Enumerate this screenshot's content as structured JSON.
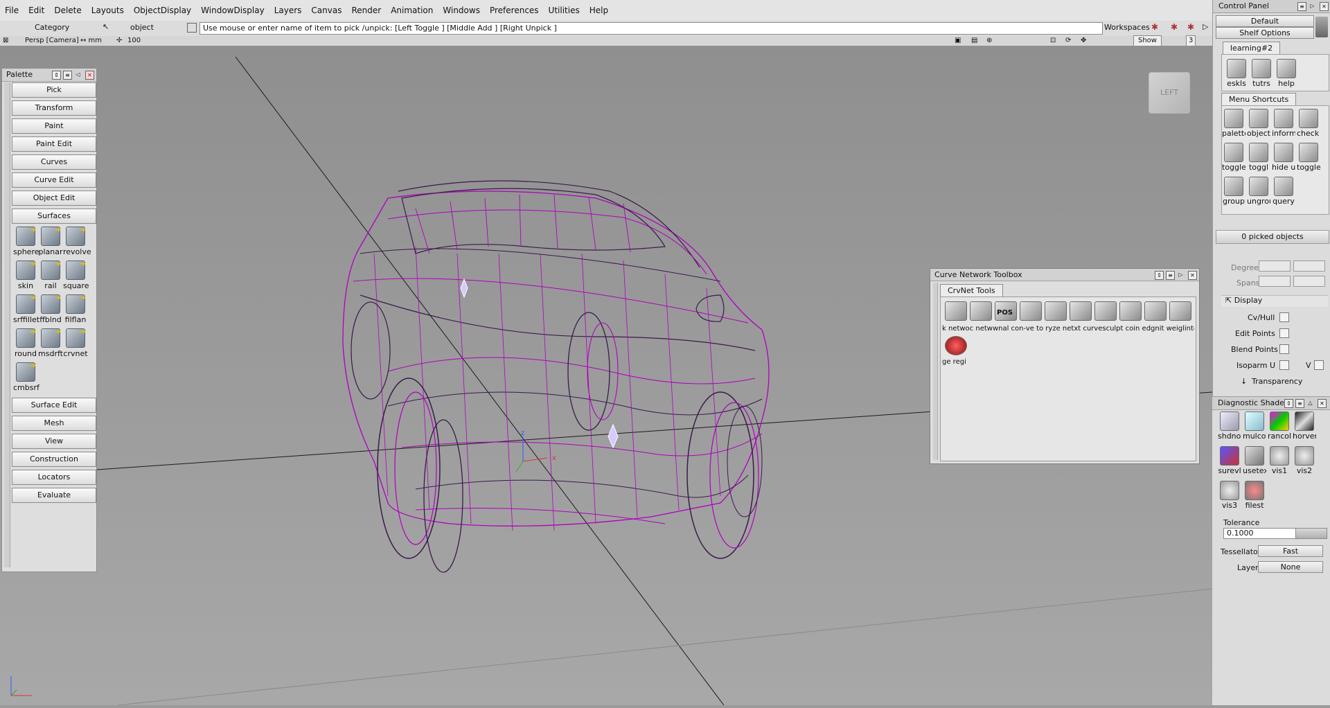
{
  "menu": [
    "File",
    "Edit",
    "Delete",
    "Layouts",
    "ObjectDisplay",
    "WindowDisplay",
    "Layers",
    "Canvas",
    "Render",
    "Animation",
    "Windows",
    "Preferences",
    "Utilities",
    "Help"
  ],
  "row2": {
    "category": "Category",
    "object": "object",
    "prompt": "Use mouse or enter name of item to pick /unpick: [Left Toggle ] [Middle Add ] [Right Unpick ]",
    "workspaces": "Workspaces"
  },
  "row3": {
    "camera": "Persp [Camera]",
    "units": "↔ mm",
    "grid": "100",
    "show": "Show",
    "num": "3"
  },
  "viewcube": "LEFT",
  "palette": {
    "title": "Palette",
    "top_buttons": [
      "Pick",
      "Transform",
      "Paint",
      "Paint Edit",
      "Curves",
      "Curve Edit",
      "Object Edit"
    ],
    "section": "Surfaces",
    "tools": [
      "sphere",
      "planar",
      "revolve",
      "skin",
      "rail",
      "square",
      "srffillet",
      "ffblnd",
      "filflan",
      "round",
      "msdrft",
      "crvnet",
      "cmbsrf"
    ],
    "bottom_buttons": [
      "Surface Edit",
      "Mesh",
      "View",
      "Construction",
      "Locators",
      "Evaluate"
    ]
  },
  "control_panel": {
    "title": "Control Panel",
    "default": "Default",
    "shelf_options": "Shelf Options",
    "shelf_tab": "learning#2",
    "shelf_icons": [
      "eskls",
      "tutrs",
      "help"
    ],
    "menu_shortcuts_tab": "Menu Shortcuts",
    "shortcut_icons": [
      "palette",
      "object",
      "inform",
      "check r",
      "toggle",
      "toggl",
      "hide u",
      "toggle",
      "group",
      "ungrou",
      "query"
    ],
    "picked": "0 picked objects",
    "degree": "Degree",
    "spans": "Spans",
    "display": "Display",
    "cvhull": "Cv/Hull",
    "edit_points": "Edit Points",
    "blend_points": "Blend Points",
    "isoparm_u": "Isoparm U",
    "isoparm_v": "V",
    "transparency": "Transparency"
  },
  "curve_network": {
    "title": "Curve Network Toolbox",
    "tab": "CrvNet Tools",
    "labels_row": "k netwoс netwwnal con-ve to ryze netxt curvesculpt coin edgnit weiglintersec",
    "second_label": "ge regi",
    "pos_label": "POS"
  },
  "diagnostic": {
    "title": "Diagnostic Shade",
    "icons": [
      "shdnon",
      "mulcol",
      "rancol",
      "horver",
      "surevl",
      "usetex",
      "vis1",
      "vis2",
      "vis3",
      "filest"
    ],
    "tolerance_label": "Tolerance",
    "tolerance_value": "0.1000",
    "tessellator_label": "Tessellator",
    "tessellator_value": "Fast",
    "layer_label": "Layer",
    "layer_value": "None"
  },
  "axis": {
    "z": "z",
    "x": "x"
  },
  "colors": {
    "wire_magenta": "#b000c0",
    "wire_dark": "#3a1a4a",
    "viewport_bg": "#9a9a9a"
  }
}
